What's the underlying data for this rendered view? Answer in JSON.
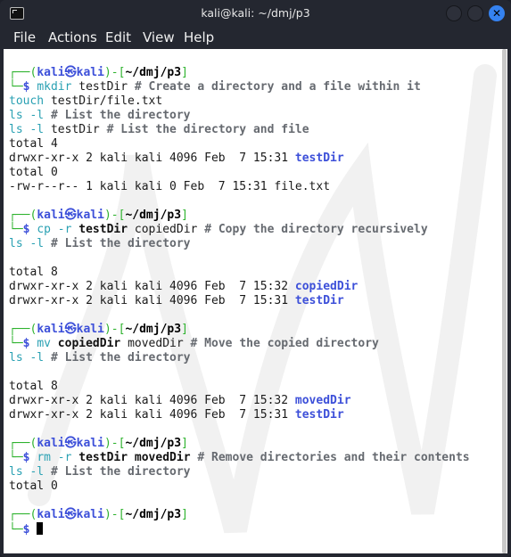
{
  "window": {
    "title": "kali@kali: ~/dmj/p3",
    "buttons": {
      "minimize": "",
      "maximize": "",
      "close": "✕"
    }
  },
  "menu": [
    "File",
    "Actions",
    "Edit",
    "View",
    "Help"
  ],
  "prompt": {
    "user": "kali",
    "symbol": "㉿",
    "host": "kali",
    "path": "~/dmj/p3",
    "dollar": "$"
  },
  "blocks": [
    {
      "command": {
        "name": "mkdir",
        "args": [
          {
            "text": "testDir",
            "bold": false
          }
        ],
        "comment": "# Create a directory and a file within it"
      },
      "continuations": [
        {
          "name": "touch",
          "args": [
            {
              "text": "testDir/file.txt",
              "bold": false
            }
          ],
          "comment": ""
        },
        {
          "name": "ls -l",
          "args": [],
          "comment": "# List the directory"
        },
        {
          "name": "ls -l",
          "args": [
            {
              "text": "testDir",
              "bold": false
            }
          ],
          "comment": "# List the directory and file"
        }
      ],
      "output": [
        {
          "text": "total 4",
          "dir": ""
        },
        {
          "text": "drwxr-xr-x 2 kali kali 4096 Feb  7 15:31 ",
          "dir": "testDir"
        },
        {
          "text": "total 0",
          "dir": ""
        },
        {
          "text": "-rw-r--r-- 1 kali kali 0 Feb  7 15:31 file.txt",
          "dir": ""
        }
      ]
    },
    {
      "command": {
        "name": "cp -r",
        "args": [
          {
            "text": "testDir",
            "bold": true
          },
          {
            "text": "copiedDir",
            "bold": false
          }
        ],
        "comment": "# Copy the directory recursively"
      },
      "continuations": [
        {
          "name": "ls -l",
          "args": [],
          "comment": "# List the directory"
        }
      ],
      "output": [
        {
          "text": "",
          "dir": ""
        },
        {
          "text": "total 8",
          "dir": ""
        },
        {
          "text": "drwxr-xr-x 2 kali kali 4096 Feb  7 15:32 ",
          "dir": "copiedDir"
        },
        {
          "text": "drwxr-xr-x 2 kali kali 4096 Feb  7 15:31 ",
          "dir": "testDir"
        }
      ]
    },
    {
      "command": {
        "name": "mv",
        "args": [
          {
            "text": "copiedDir",
            "bold": true
          },
          {
            "text": "movedDir",
            "bold": false
          }
        ],
        "comment": "# Move the copied directory"
      },
      "continuations": [
        {
          "name": "ls -l",
          "args": [],
          "comment": "# List the directory"
        }
      ],
      "output": [
        {
          "text": "",
          "dir": ""
        },
        {
          "text": "total 8",
          "dir": ""
        },
        {
          "text": "drwxr-xr-x 2 kali kali 4096 Feb  7 15:32 ",
          "dir": "movedDir"
        },
        {
          "text": "drwxr-xr-x 2 kali kali 4096 Feb  7 15:31 ",
          "dir": "testDir"
        }
      ]
    },
    {
      "command": {
        "name": "rm -r",
        "args": [
          {
            "text": "testDir",
            "bold": true
          },
          {
            "text": "movedDir",
            "bold": true
          }
        ],
        "comment": "# Remove directories and their contents"
      },
      "continuations": [
        {
          "name": "ls -l",
          "args": [],
          "comment": "# List the directory"
        }
      ],
      "output": [
        {
          "text": "total 0",
          "dir": ""
        }
      ]
    }
  ],
  "colors": {
    "prompt_frame": "#2fb32f",
    "prompt_user": "#3d50d9",
    "command": "#2aa1b3",
    "comment": "#666a70",
    "directory": "#3d50d9",
    "close_button": "#3582f0"
  }
}
